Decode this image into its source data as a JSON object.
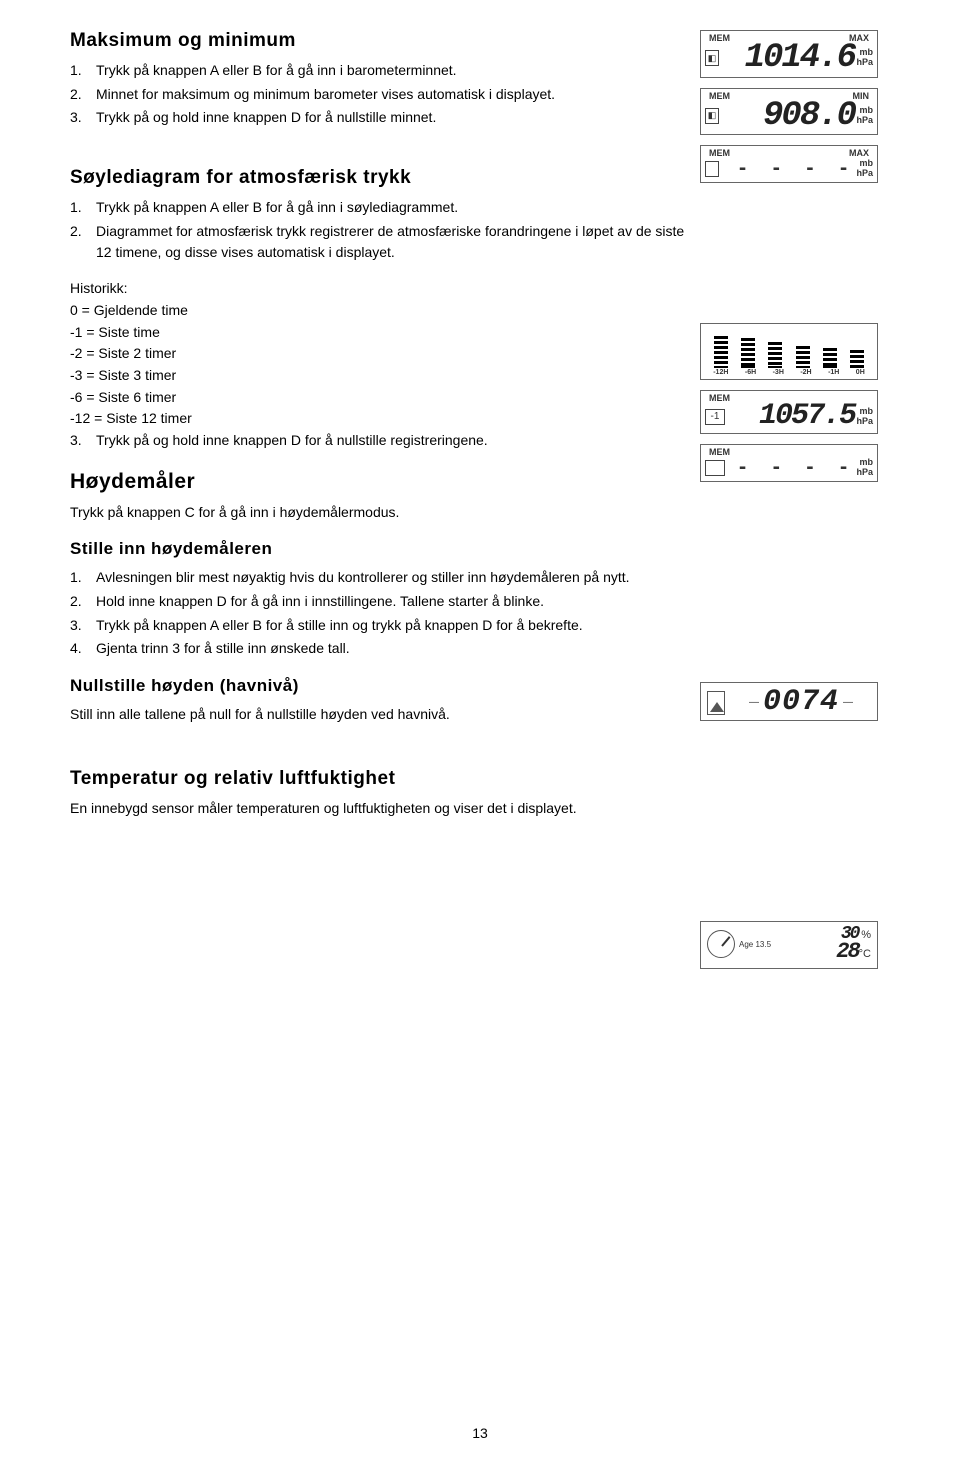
{
  "s1": {
    "title": "Maksimum og minimum",
    "items": {
      "n1": "1.",
      "t1": "Trykk på knappen A eller B for å gå inn i barometerminnet.",
      "n2": "2.",
      "t2": "Minnet for maksimum og minimum barometer vises automatisk i displayet.",
      "n3": "3.",
      "t3": "Trykk på og hold inne knappen D for å nullstille minnet."
    }
  },
  "s2": {
    "title": "Søylediagram for atmosfærisk trykk",
    "items": {
      "n1": "1.",
      "t1": "Trykk på knappen A eller B for å gå inn i søylediagrammet.",
      "n2": "2.",
      "t2": "Diagrammet for atmosfærisk trykk registrerer de atmosfæriske forandringene i løpet av de siste 12 timene, og disse vises automatisk i displayet."
    },
    "hist_title": "Historikk:",
    "hist": {
      "l0": "0 = Gjeldende time",
      "l1": "-1 = Siste time",
      "l2": "-2 = Siste 2 timer",
      "l3": "-3 = Siste 3 timer",
      "l6": "-6 = Siste 6 timer",
      "l12": "-12 = Siste 12 timer"
    },
    "n3": "3.",
    "t3": "Trykk på og hold inne knappen D for å nullstille registreringene."
  },
  "s3": {
    "title": "Høydemåler",
    "intro": "Trykk på knappen C for å gå inn i høydemålermodus."
  },
  "s4": {
    "title": "Stille inn høydemåleren",
    "items": {
      "n1": "1.",
      "t1": "Avlesningen blir mest nøyaktig hvis du kontrollerer og stiller inn høydemåleren på nytt.",
      "n2": "2.",
      "t2": "Hold inne knappen D for å gå inn i innstillingene. Tallene starter å blinke.",
      "n3": "3.",
      "t3": " Trykk på knappen A eller B for å stille inn og trykk på knappen D for å bekrefte.",
      "n4": "4.",
      "t4": "Gjenta trinn 3 for å stille inn ønskede tall."
    }
  },
  "s5": {
    "title": "Nullstille høyden (havnivå)",
    "p": "Still inn alle tallene på null for å nullstille høyden ved havnivå."
  },
  "s6": {
    "title": "Temperatur og relativ luftfuktighet",
    "p": "En innebygd sensor måler temperaturen og luftfuktigheten og viser det i displayet."
  },
  "page_number": "13",
  "lcd": {
    "mem": "MEM",
    "max": "MAX",
    "min": "MIN",
    "mb": "mb",
    "hpa": "hPa",
    "v1": "1014.6",
    "v2": "908.0",
    "dashes": "- - - -",
    "bar_labels": {
      "a": "-12H",
      "b": "-6H",
      "c": "-3H",
      "d": "-2H",
      "e": "-1H",
      "f": "0H"
    },
    "v3": "1057.5",
    "neg1": "-1",
    "alt": "0074",
    "age_lbl": "Age",
    "age_v": "13.5",
    "hum": "30",
    "hum_unit": "%",
    "temp": "28",
    "temp_unit": "°C"
  }
}
